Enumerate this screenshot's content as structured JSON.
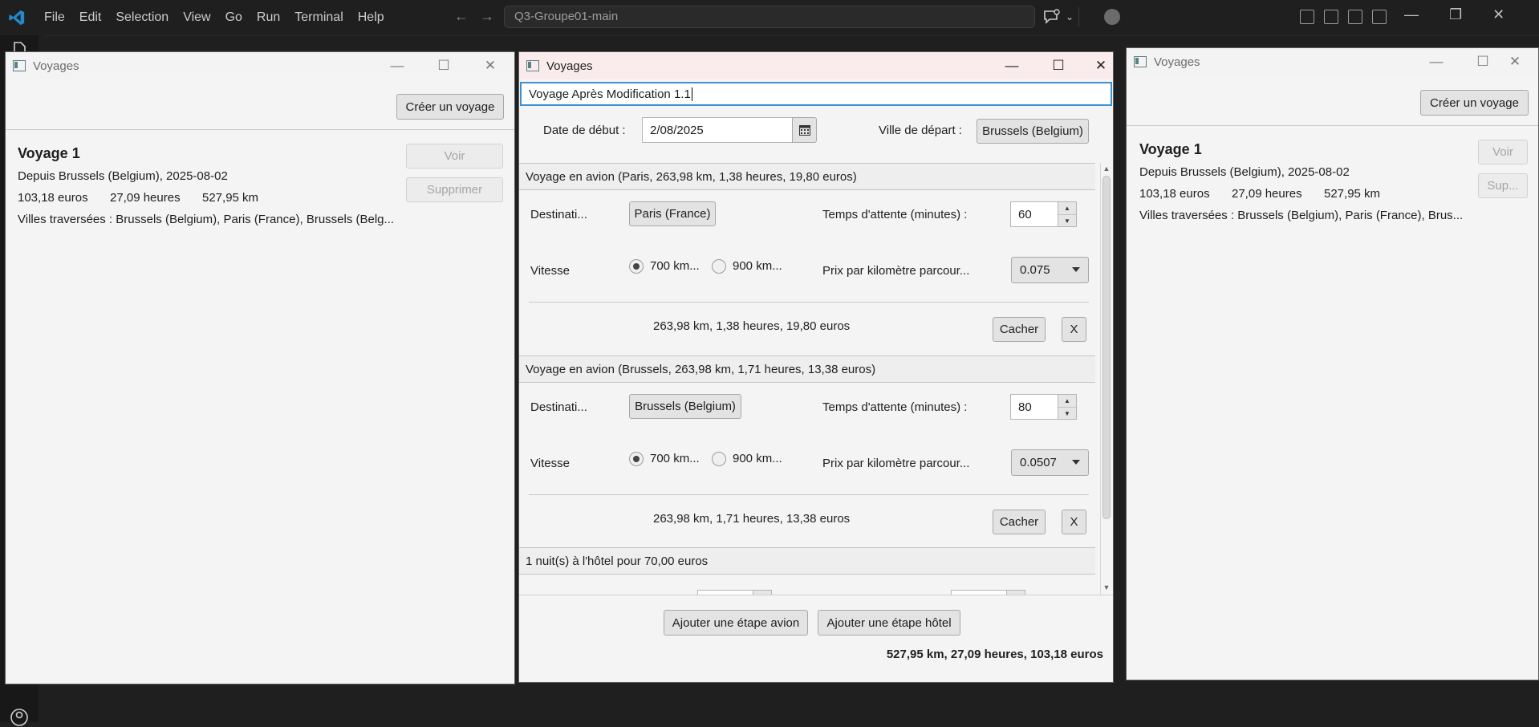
{
  "vscode": {
    "menu": [
      "File",
      "Edit",
      "Selection",
      "View",
      "Go",
      "Run",
      "Terminal",
      "Help"
    ],
    "search_text": "Q3-Groupe01-main"
  },
  "window_title": "Voyages",
  "left_window": {
    "create_button": "Créer un voyage",
    "trip": {
      "title": "Voyage 1",
      "departure": "Depuis Brussels (Belgium), 2025-08-02",
      "price": "103,18 euros",
      "hours": "27,09 heures",
      "km": "527,95 km",
      "cities": "Villes traversées : Brussels (Belgium), Paris (France), Brussels (Belg..."
    },
    "view_button": "Voir",
    "delete_button": "Supprimer"
  },
  "right_window": {
    "create_button": "Créer un voyage",
    "trip": {
      "title": "Voyage 1",
      "departure": "Depuis Brussels (Belgium), 2025-08-02",
      "price": "103,18 euros",
      "hours": "27,09 heures",
      "km": "527,95 km",
      "cities": "Villes traversées : Brussels (Belgium), Paris (France), Brus..."
    },
    "view_button": "Voir",
    "delete_button": "Sup..."
  },
  "editor": {
    "name_value": "Voyage Après Modification 1.1",
    "start_date_label": "Date de début :",
    "start_date_value": "2/08/2025",
    "departure_label": "Ville de départ :",
    "departure_value": "Brussels (Belgium)",
    "steps": [
      {
        "header": "Voyage en avion (Paris, 263,98 km, 1,38 heures, 19,80 euros)",
        "destination_label": "Destinati...",
        "destination_value": "Paris (France)",
        "wait_label": "Temps d'attente (minutes) :",
        "wait_value": "60",
        "speed_label": "Vitesse",
        "speed_option_1": "700 km...",
        "speed_option_2": "900 km...",
        "price_label": "Prix par kilomètre parcour...",
        "price_value": "0.075",
        "summary": "263,98 km, 1,38 heures, 19,80 euros",
        "hide_button": "Cacher",
        "remove_button": "X"
      },
      {
        "header": "Voyage en avion (Brussels, 263,98 km, 1,71 heures, 13,38 euros)",
        "destination_label": "Destinati...",
        "destination_value": "Brussels (Belgium)",
        "wait_label": "Temps d'attente (minutes) :",
        "wait_value": "80",
        "speed_label": "Vitesse",
        "speed_option_1": "700 km...",
        "speed_option_2": "900 km...",
        "price_label": "Prix par kilomètre parcour...",
        "price_value": "0.0507",
        "summary": "263,98 km, 1,71 heures, 13,38 euros",
        "hide_button": "Cacher",
        "remove_button": "X"
      }
    ],
    "hotel_header": "1 nuit(s) à l'hôtel pour 70,00 euros",
    "add_plane_button": "Ajouter une étape avion",
    "add_hotel_button": "Ajouter une étape hôtel",
    "total": "527,95 km, 27,09 heures, 103,18 euros"
  }
}
